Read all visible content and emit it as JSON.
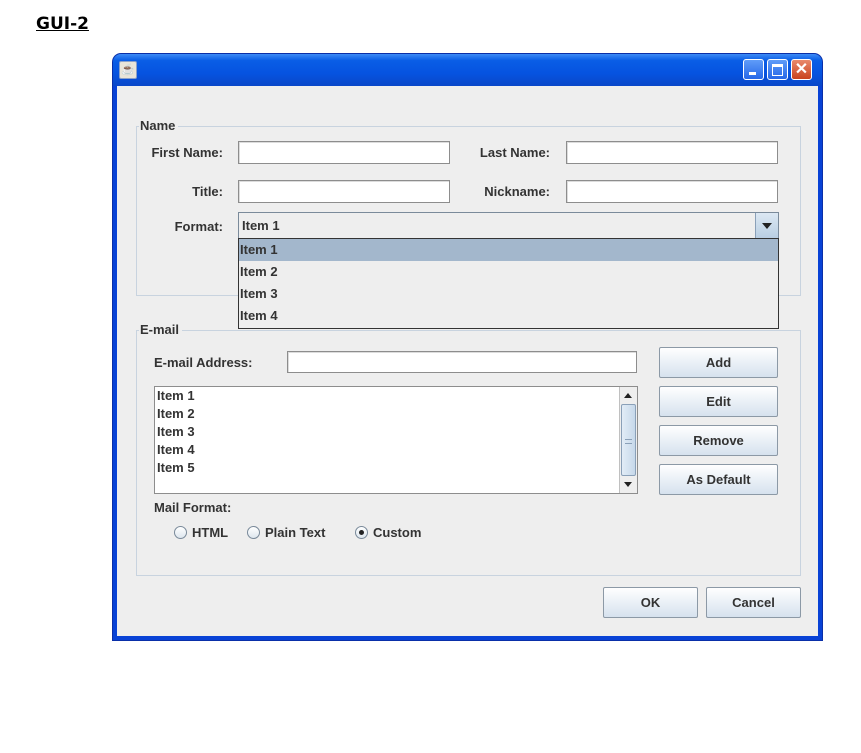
{
  "document": {
    "heading": "GUI-2"
  },
  "window": {
    "title": "",
    "icon": "java-coffee-icon",
    "controls": {
      "minimize": "minimize",
      "maximize": "maximize",
      "close": "✕"
    }
  },
  "name_group": {
    "title": "Name",
    "first_name": {
      "label": "First Name:",
      "value": ""
    },
    "last_name": {
      "label": "Last Name:",
      "value": ""
    },
    "title_field": {
      "label": "Title:",
      "value": ""
    },
    "nickname": {
      "label": "Nickname:",
      "value": ""
    },
    "format": {
      "label": "Format:",
      "selected": "Item 1",
      "expanded": true,
      "options": [
        "Item 1",
        "Item 2",
        "Item 3",
        "Item 4"
      ]
    }
  },
  "email_group": {
    "title": "E-mail",
    "address": {
      "label": "E-mail Address:",
      "value": ""
    },
    "list_items": [
      "Item 1",
      "Item 2",
      "Item 3",
      "Item 4",
      "Item 5"
    ],
    "buttons": {
      "add": "Add",
      "edit": "Edit",
      "remove": "Remove",
      "as_default": "As Default"
    },
    "mail_format": {
      "label": "Mail Format:",
      "options": [
        {
          "label": "HTML",
          "selected": false
        },
        {
          "label": "Plain Text",
          "selected": false
        },
        {
          "label": "Custom",
          "selected": true
        }
      ]
    }
  },
  "footer": {
    "ok": "OK",
    "cancel": "Cancel"
  }
}
